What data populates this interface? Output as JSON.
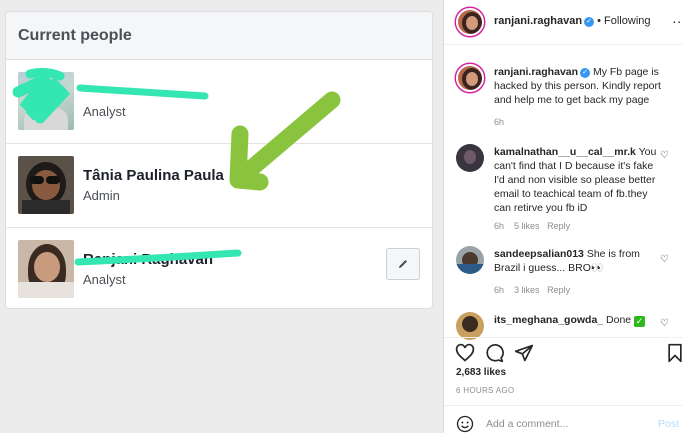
{
  "fb_panel": {
    "title": "Current people",
    "people": [
      {
        "name": "",
        "role": "Analyst"
      },
      {
        "name": "Tânia Paulina Paula",
        "role": "Admin"
      },
      {
        "name": "Ranjani Raghavan",
        "role": "Analyst"
      }
    ]
  },
  "instagram": {
    "header": {
      "username": "ranjani.raghavan",
      "separator": "•",
      "follow_status": "Following",
      "menu": "..."
    },
    "caption": {
      "username": "ranjani.raghavan",
      "text": "My Fb page is hacked by this person. Kindly report and help me to get back my page",
      "time": "6h"
    },
    "comments": [
      {
        "username": "kamalnathan__u__cal__mr.k",
        "text": "You can't find that I D because it's fake I'd and non visible so please better email to teachical team of fb.they can retirve you fb iD",
        "time": "6h",
        "likes": "5 likes",
        "reply": "Reply"
      },
      {
        "username": "sandeepsalian013",
        "text": "She is from Brazil i guess... BRO",
        "emoji": "👀",
        "time": "6h",
        "likes": "3 likes",
        "reply": "Reply"
      },
      {
        "username": "its_meghana_gowda_",
        "text": "Done",
        "emoji": "✓"
      }
    ],
    "likes_count": "2,683 likes",
    "time_ago": "6 HOURS AGO",
    "add_comment_placeholder": "Add a comment...",
    "post_label": "Post"
  },
  "colors": {
    "scribble": "#34e6b1",
    "arrow": "#8ac43f",
    "ig_link": "#3897f0",
    "post_disabled": "#b3dbff"
  }
}
